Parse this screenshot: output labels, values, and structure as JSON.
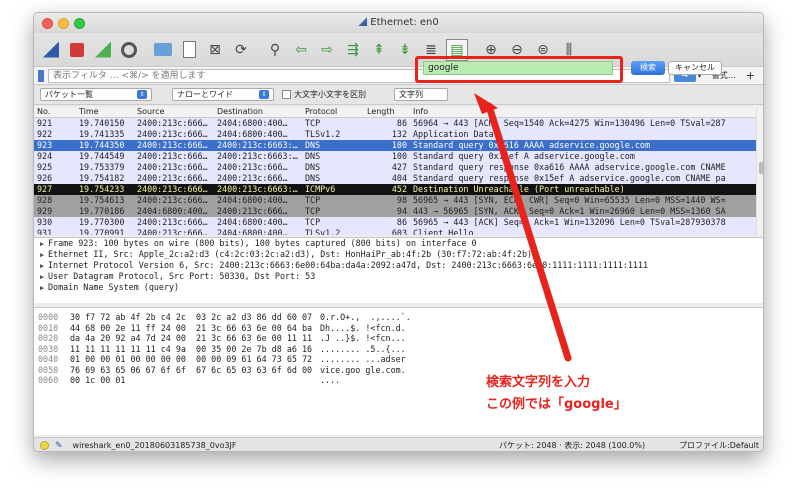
{
  "window": {
    "title": "Ethernet: en0"
  },
  "toolbar": {
    "icons": [
      "shark-fin-start-icon",
      "stop-capture-icon",
      "restart-capture-icon",
      "capture-options-icon",
      "open-file-icon",
      "save-file-icon",
      "close-file-icon",
      "reload-file-icon",
      "find-packet-icon",
      "go-back-icon",
      "go-forward-icon",
      "go-to-packet-icon",
      "go-first-icon",
      "go-last-icon",
      "autoscroll-icon",
      "colorize-icon",
      "zoom-in-icon",
      "zoom-out-icon",
      "zoom-normal-icon",
      "resize-columns-icon"
    ]
  },
  "filter": {
    "placeholder": "表示フィルタ … <⌘/> を適用します",
    "expression_label": "書式…",
    "add_label": "+"
  },
  "search": {
    "mode": "パケット一覧",
    "type": "ナローとワイド",
    "case_label": "大文字小文字を区別",
    "string_type": "文字列",
    "query": "google",
    "search_button": "検索",
    "cancel_button": "キャンセル"
  },
  "packets": {
    "columns": [
      "No.",
      "Time",
      "Source",
      "Destination",
      "Protocol",
      "Length",
      "Info"
    ],
    "rows": [
      {
        "no": "921",
        "time": "19.740150",
        "src": "2400:213c:666…",
        "dst": "2404:6800:400…",
        "proto": "TCP",
        "len": "86",
        "info": "56964 → 443 [ACK] Seq=1540 Ack=4275 Win=130496 Len=0 TSval=287",
        "style": "lightblue",
        "mark": ""
      },
      {
        "no": "922",
        "time": "19.741335",
        "src": "2400:213c:666…",
        "dst": "2404:6800:400…",
        "proto": "TLSv1.2",
        "len": "132",
        "info": "Application Data",
        "style": "lightblue",
        "mark": ""
      },
      {
        "no": "923",
        "time": "19.744350",
        "src": "2400:213c:666…",
        "dst": "2400:213c:6663:…",
        "proto": "DNS",
        "len": "100",
        "info": "Standard query 0xa616 AAAA adservice.google.com",
        "style": "selected",
        "mark": "→"
      },
      {
        "no": "924",
        "time": "19.744549",
        "src": "2400:213c:666…",
        "dst": "2400:213c:6663:…",
        "proto": "DNS",
        "len": "100",
        "info": "Standard query 0x15ef A adservice.google.com",
        "style": "lightblue",
        "mark": ""
      },
      {
        "no": "925",
        "time": "19.753379",
        "src": "2400:213c:666…",
        "dst": "2400:213c:666…",
        "proto": "DNS",
        "len": "427",
        "info": "Standard query response 0xa616 AAAA adservice.google.com CNAME",
        "style": "lightblue",
        "mark": ""
      },
      {
        "no": "926",
        "time": "19.754182",
        "src": "2400:213c:666…",
        "dst": "2400:213c:666…",
        "proto": "DNS",
        "len": "404",
        "info": "Standard query response 0x15ef A adservice.google.com CNAME pa",
        "style": "lightblue",
        "mark": ""
      },
      {
        "no": "927",
        "time": "19.754233",
        "src": "2400:213c:666…",
        "dst": "2400:213c:6663:…",
        "proto": "ICMPv6",
        "len": "452",
        "info": "Destination Unreachable (Port unreachable)",
        "style": "black",
        "mark": ""
      },
      {
        "no": "928",
        "time": "19.754613",
        "src": "2400:213c:666…",
        "dst": "2404:6800:400…",
        "proto": "TCP",
        "len": "98",
        "info": "56965 → 443 [SYN, ECN, CWR] Seq=0 Win=65535 Len=0 MSS=1440 WS=",
        "style": "gray",
        "mark": ""
      },
      {
        "no": "929",
        "time": "19.770186",
        "src": "2404:6800:400…",
        "dst": "2400:213c:666…",
        "proto": "TCP",
        "len": "94",
        "info": "443 → 56965 [SYN, ACK] Seq=0 Ack=1 Win=26960 Len=0 MSS=1360 SA",
        "style": "gray",
        "mark": ""
      },
      {
        "no": "930",
        "time": "19.770300",
        "src": "2400:213c:666…",
        "dst": "2404:6800:400…",
        "proto": "TCP",
        "len": "86",
        "info": "56965 → 443 [ACK] Seq=1 Ack=1 Win=132096 Len=0 TSval=287930378",
        "style": "lightblue",
        "mark": ""
      },
      {
        "no": "931",
        "time": "19.770991",
        "src": "2400:213c:666…",
        "dst": "2404:6800:400…",
        "proto": "TLSv1.2",
        "len": "603",
        "info": "Client Hello",
        "style": "lightblue",
        "mark": ""
      }
    ]
  },
  "details": [
    "Frame 923: 100 bytes on wire (800 bits), 100 bytes captured (800 bits) on interface 0",
    "Ethernet II, Src: Apple_2c:a2:d3 (c4:2c:03:2c:a2:d3), Dst: HonHaiPr_ab:4f:2b (30:f7:72:ab:4f:2b)",
    "Internet Protocol Version 6, Src: 2400:213c:6663:6e00:64ba:da4a:2092:a47d, Dst: 2400:213c:6663:6e00:1111:1111:1111:1111",
    "User Datagram Protocol, Src Port: 50330, Dst Port: 53",
    "Domain Name System (query)"
  ],
  "hex": [
    {
      "off": "0000",
      "bytes": "30 f7 72 ab 4f 2b c4 2c  03 2c a2 d3 86 dd 60 07",
      "ascii": "0.r.O+.,  .,....`."
    },
    {
      "off": "0010",
      "bytes": "44 68 00 2e 11 ff 24 00  21 3c 66 63 6e 00 64 ba",
      "ascii": "Dh....$. !<fcn.d."
    },
    {
      "off": "0020",
      "bytes": "da 4a 20 92 a4 7d 24 00  21 3c 66 63 6e 00 11 11",
      "ascii": ".J ..}$. !<fcn..."
    },
    {
      "off": "0030",
      "bytes": "11 11 11 11 11 11 c4 9a  00 35 00 2e 7b d8 a6 16",
      "ascii": "........ .5..{..."
    },
    {
      "off": "0040",
      "bytes": "01 00 00 01 00 00 00 00  00 00 09 61 64 73 65 72",
      "ascii": "........ ...adser"
    },
    {
      "off": "0050",
      "bytes": "76 69 63 65 06 67 6f 6f  67 6c 65 03 63 6f 6d 00",
      "ascii": "vice.goo gle.com."
    },
    {
      "off": "0060",
      "bytes": "00 1c 00 01",
      "ascii": "...."
    }
  ],
  "status": {
    "file": "wireshark_en0_20180603185738_0vo3JF",
    "packets": "パケット: 2048 · 表示: 2048 (100.0%)",
    "profile": "プロファイル:Default"
  },
  "annotation": {
    "line1": "検索文字列を入力",
    "line2": "この例では「google」"
  },
  "colors": {
    "highlight_red": "#e8231c",
    "selected_row": "#3b6fc9",
    "search_green": "#b8ecb0"
  }
}
